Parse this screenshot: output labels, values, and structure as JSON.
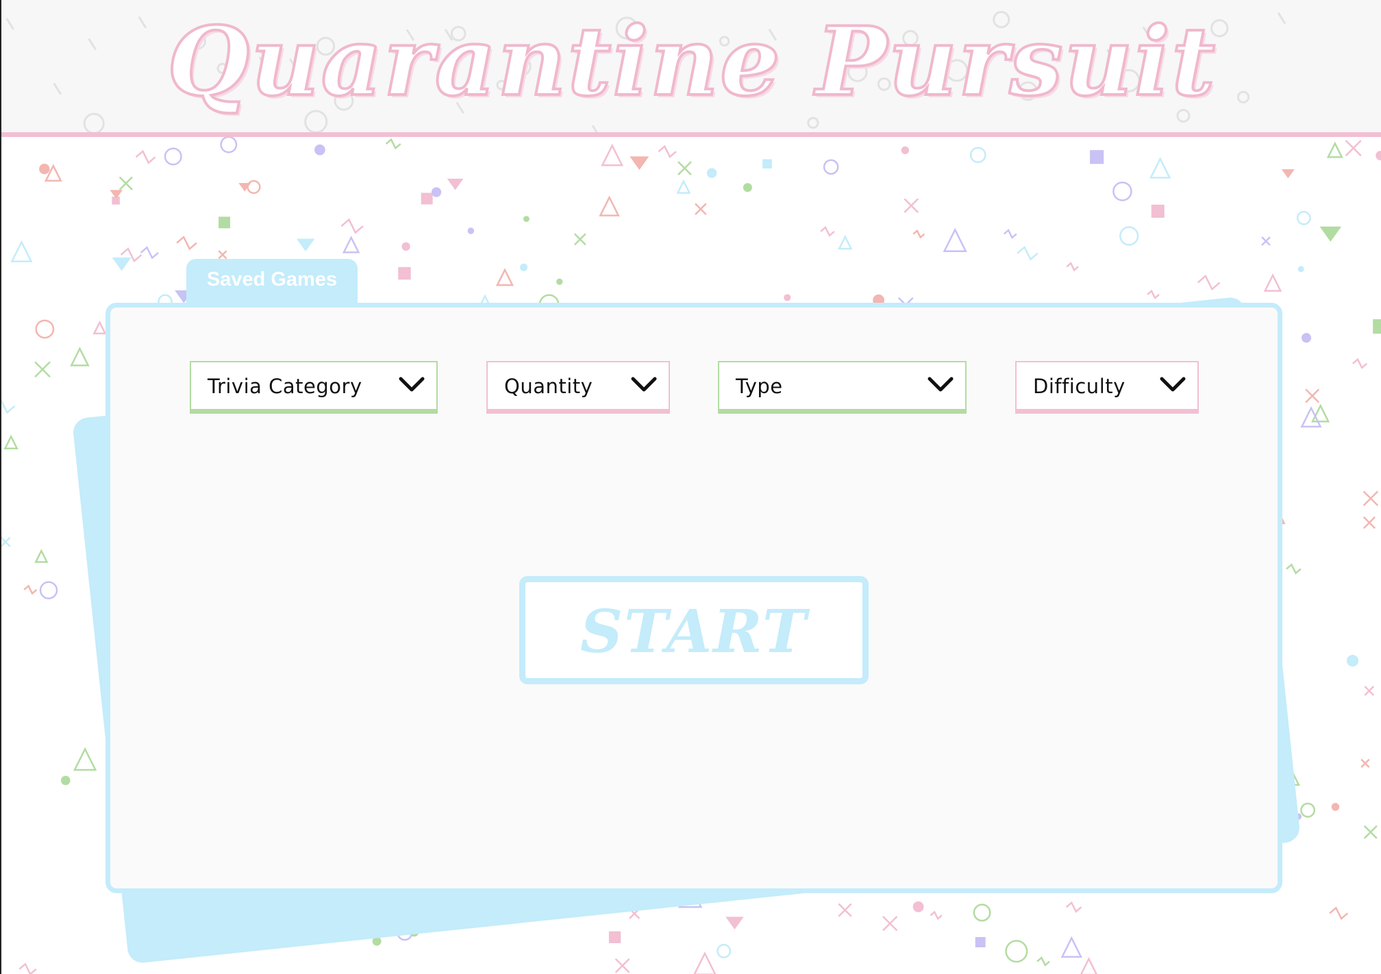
{
  "app": {
    "title": "Quarantine Pursuit"
  },
  "folder": {
    "tab_label": "Saved Games"
  },
  "filters": {
    "category": {
      "label": "Trivia Category"
    },
    "quantity": {
      "label": "Quantity"
    },
    "type": {
      "label": "Type"
    },
    "difficulty": {
      "label": "Difficulty"
    }
  },
  "start_button": {
    "label": "START"
  },
  "colors": {
    "pink": "#f2bfd3",
    "light_blue": "#c4ecfa",
    "green": "#b2dca2",
    "purple": "#c8c2f5",
    "coral": "#f3b6b0"
  }
}
